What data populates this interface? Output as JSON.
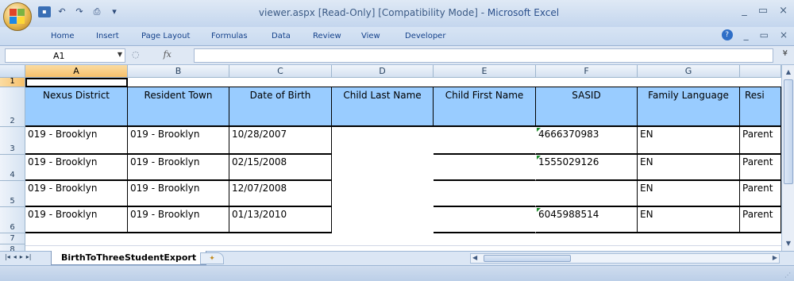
{
  "window": {
    "title": "viewer.aspx  [Read-Only]  [Compatibility Mode] - ",
    "app_name": "Microsoft Excel",
    "controls": [
      "_",
      "▭",
      "×"
    ]
  },
  "quick_access": {
    "save": "▪",
    "undo": "↶",
    "redo": "↷",
    "print_preview": "⎙",
    "dropdown": "▾"
  },
  "ribbon_tabs": [
    "Home",
    "Insert",
    "Page Layout",
    "Formulas",
    "Data",
    "Review",
    "View",
    "Developer"
  ],
  "ribbon_controls": {
    "help": "?",
    "minimize": "_",
    "restore": "▭",
    "close": "×"
  },
  "formula_bar": {
    "name_box": "A1",
    "fx": "fx",
    "value": ""
  },
  "columns": [
    "A",
    "B",
    "C",
    "D",
    "E",
    "F",
    "G",
    ""
  ],
  "rows": [
    "1",
    "2",
    "3",
    "4",
    "5",
    "6",
    "7",
    "8"
  ],
  "table": {
    "headers": [
      "Nexus District",
      "Resident Town",
      "Date of Birth",
      "Child Last Name",
      "Child First Name",
      "SASID",
      "Family Language",
      "Resi"
    ],
    "data": [
      [
        "019 - Brooklyn",
        "019 - Brooklyn",
        "10/28/2007",
        "",
        "",
        "4666370983",
        "EN",
        "Parent"
      ],
      [
        "019 - Brooklyn",
        "019 - Brooklyn",
        "02/15/2008",
        "",
        "",
        "1555029126",
        "EN",
        "Parent"
      ],
      [
        "019 - Brooklyn",
        "019 - Brooklyn",
        "12/07/2008",
        "",
        "",
        "",
        "EN",
        "Parent"
      ],
      [
        "019 - Brooklyn",
        "019 - Brooklyn",
        "01/13/2010",
        "",
        "",
        "6045988514",
        "EN",
        "Parent"
      ]
    ]
  },
  "sheet_nav": [
    "|◂",
    "◂",
    "▸",
    "▸|"
  ],
  "sheet_tabs": [
    "BirthToThreeStudentExport"
  ],
  "colors": {
    "header_fill": "#99ccff",
    "ribbon_bg": "#c9daf0",
    "selection": "#f6c06b"
  }
}
